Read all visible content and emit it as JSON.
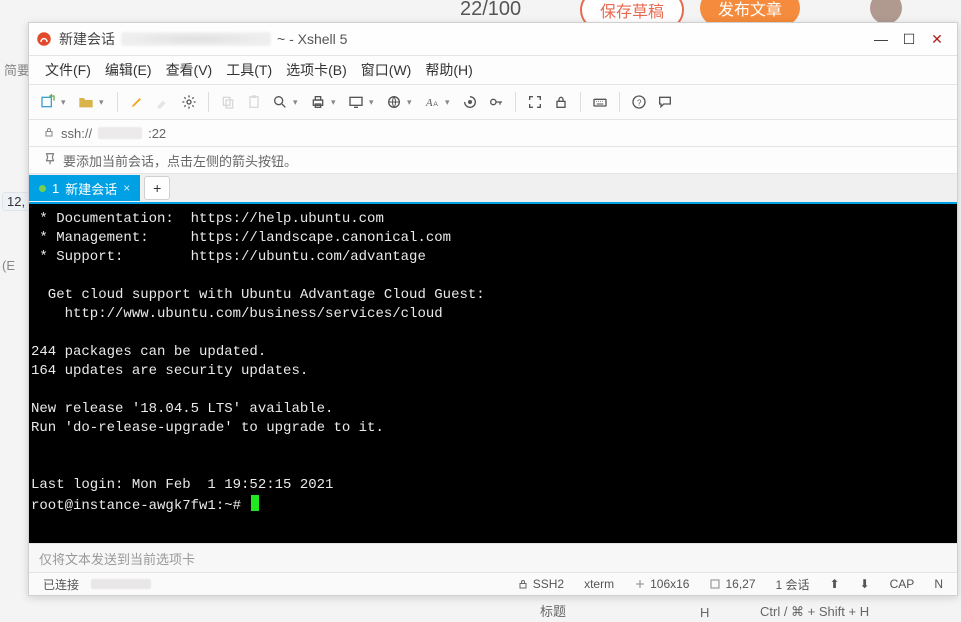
{
  "background": {
    "count_label": "22/100",
    "draft_btn": "保存草稿",
    "publish_btn": "发布文章",
    "left_pill": "12,",
    "left_e": "(E",
    "left_frag": "简要",
    "bottom_title": "标题",
    "bottom_h": "H",
    "bottom_short": "Ctrl / ⌘ + Shift + H"
  },
  "titlebar": {
    "session_name": "新建会话",
    "suffix": "~ - Xshell 5"
  },
  "menu": {
    "file": "文件(F)",
    "edit": "编辑(E)",
    "view": "查看(V)",
    "tools": "工具(T)",
    "options": "选项卡(B)",
    "window": "窗口(W)",
    "help": "帮助(H)"
  },
  "addressbar": {
    "prefix": "ssh://",
    "port": ":22"
  },
  "hint_row": {
    "text": "要添加当前会话，点击左侧的箭头按钮。"
  },
  "tabs": {
    "active_index": "1",
    "active_label": "新建会话"
  },
  "terminal_lines": [
    " * Documentation:  https://help.ubuntu.com",
    " * Management:     https://landscape.canonical.com",
    " * Support:        https://ubuntu.com/advantage",
    "",
    "  Get cloud support with Ubuntu Advantage Cloud Guest:",
    "    http://www.ubuntu.com/business/services/cloud",
    "",
    "244 packages can be updated.",
    "164 updates are security updates.",
    "",
    "New release '18.04.5 LTS' available.",
    "Run 'do-release-upgrade' to upgrade to it.",
    "",
    "",
    "Last login: Mon Feb  1 19:52:15 2021"
  ],
  "terminal_prompt": "root@instance-awgk7fw1:~# ",
  "compose_hint": "仅将文本发送到当前选项卡",
  "status": {
    "connected": "已连接",
    "lock": "SSH2",
    "term": "xterm",
    "size": "106x16",
    "pos": "16,27",
    "sessions": "1 会话",
    "cap": "CAP",
    "num": "N"
  }
}
